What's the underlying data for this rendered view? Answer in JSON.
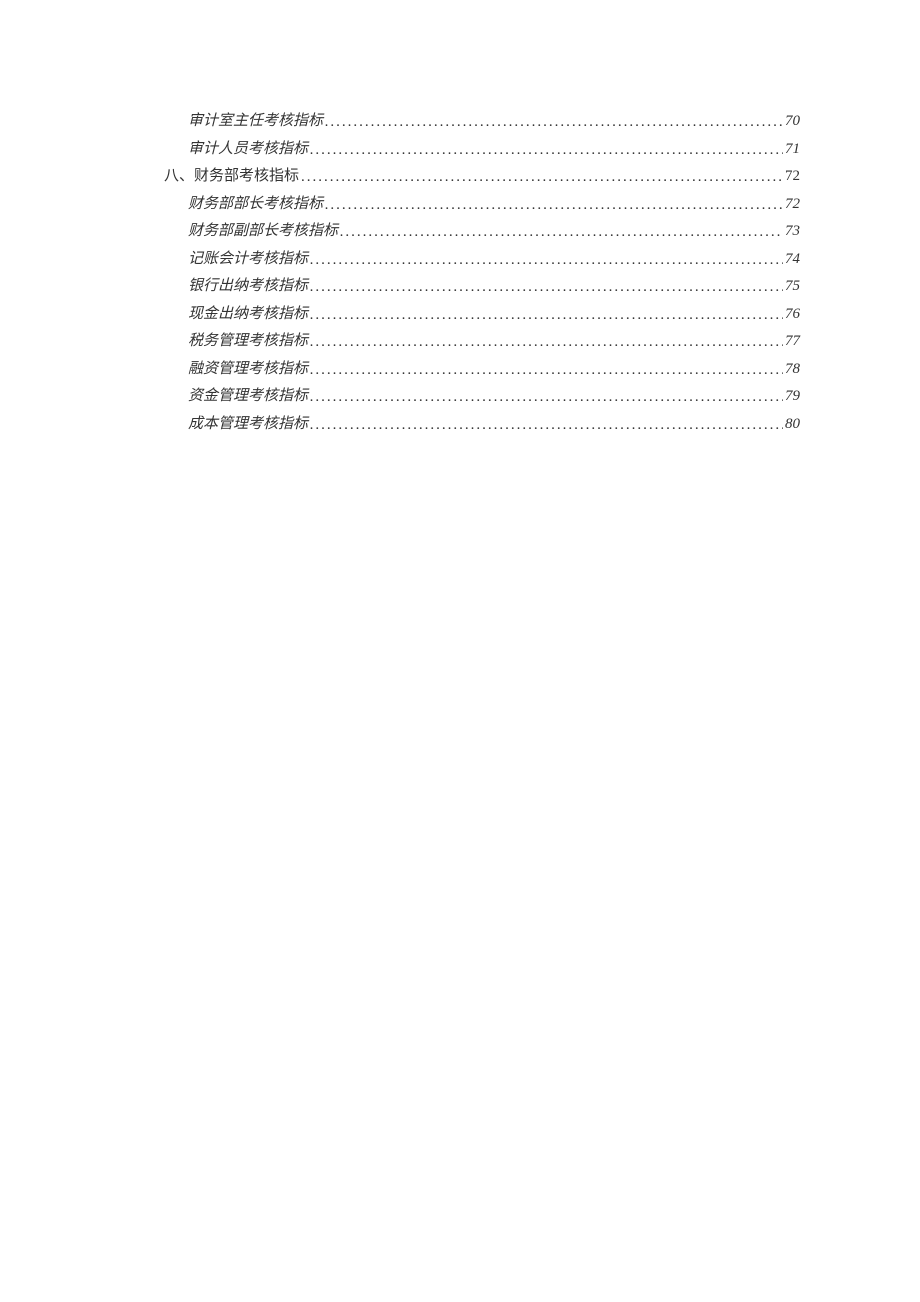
{
  "toc": {
    "entries": [
      {
        "level": 2,
        "title": "审计室主任考核指标",
        "page": "70"
      },
      {
        "level": 2,
        "title": "审计人员考核指标",
        "page": "71"
      },
      {
        "level": 1,
        "title": "八、财务部考核指标",
        "page": "72"
      },
      {
        "level": 2,
        "title": "财务部部长考核指标",
        "page": "72"
      },
      {
        "level": 2,
        "title": "财务部副部长考核指标",
        "page": "73"
      },
      {
        "level": 2,
        "title": "记账会计考核指标",
        "page": "74"
      },
      {
        "level": 2,
        "title": "银行出纳考核指标",
        "page": "75"
      },
      {
        "level": 2,
        "title": "现金出纳考核指标",
        "page": "76"
      },
      {
        "level": 2,
        "title": "税务管理考核指标",
        "page": "77"
      },
      {
        "level": 2,
        "title": "融资管理考核指标",
        "page": "78"
      },
      {
        "level": 2,
        "title": "资金管理考核指标",
        "page": "79"
      },
      {
        "level": 2,
        "title": "成本管理考核指标",
        "page": "80"
      }
    ]
  }
}
